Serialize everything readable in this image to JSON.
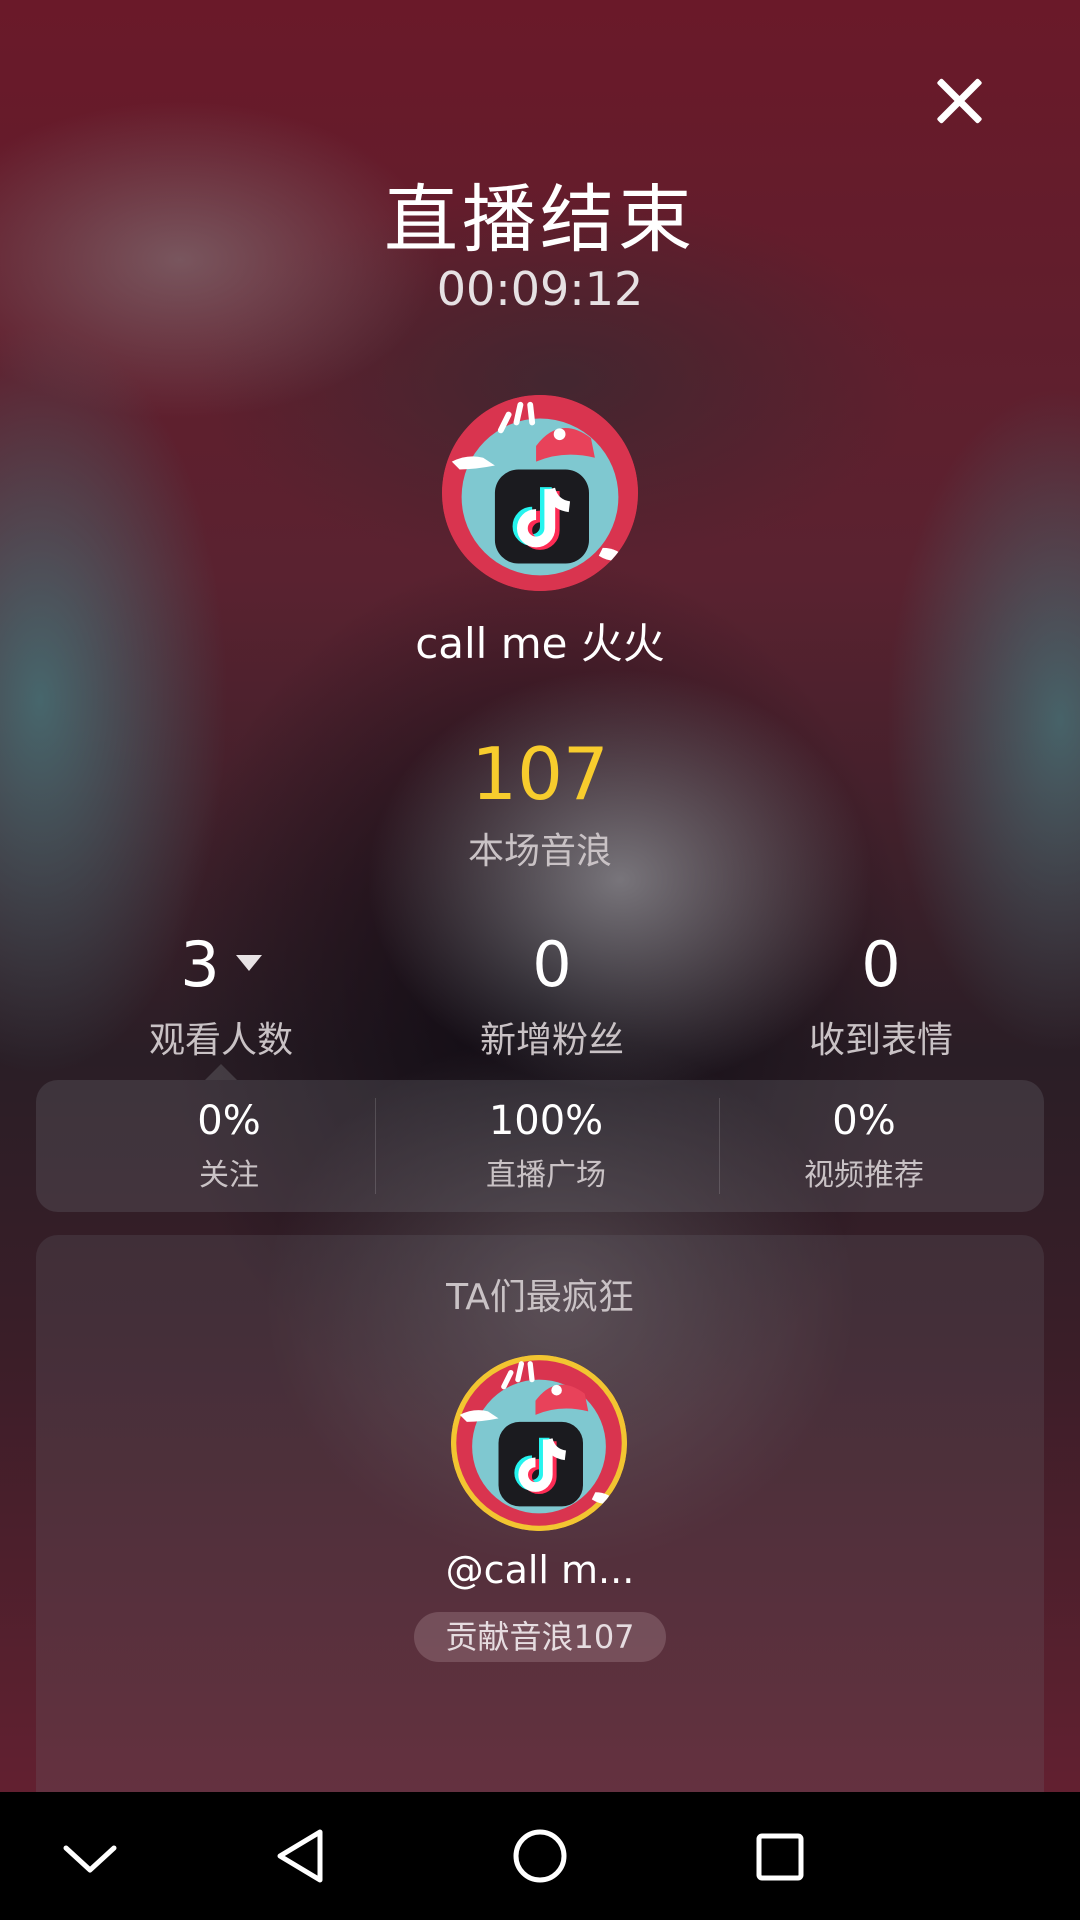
{
  "header": {
    "title": "直播结束",
    "duration": "00:09:12",
    "close_icon": "close-icon"
  },
  "host": {
    "name": "call me 火火",
    "avatar_icon": "tiktok-mascot-avatar"
  },
  "yinlang": {
    "value": "107",
    "label": "本场音浪"
  },
  "stats": [
    {
      "value": "3",
      "label": "观看人数"
    },
    {
      "value": "0",
      "label": "新增粉丝"
    },
    {
      "value": "0",
      "label": "收到表情"
    }
  ],
  "sources": [
    {
      "percent": "0%",
      "label": "关注"
    },
    {
      "percent": "100%",
      "label": "直播广场"
    },
    {
      "percent": "0%",
      "label": "视频推荐"
    }
  ],
  "top_fans": {
    "title": "TA们最疯狂",
    "fan_name": "@call m...",
    "contribution": "贡献音浪107"
  },
  "nav": [
    "chevron-down-icon",
    "back-triangle-icon",
    "home-circle-icon",
    "recent-square-icon"
  ],
  "colors": {
    "accent_gold": "#f7cc2d",
    "avatar_ring": "#d9344f",
    "top_fan_ring": "#f2c531"
  }
}
